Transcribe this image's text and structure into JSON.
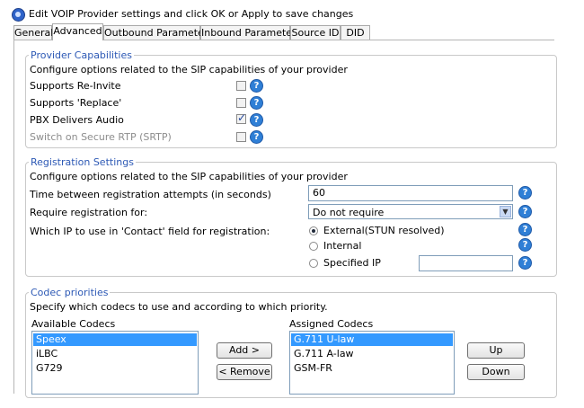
{
  "header": {
    "title": "Edit VOIP Provider settings and click OK or Apply to save changes",
    "icon": "voip-provider-icon"
  },
  "tabs": [
    {
      "label": "General",
      "active": false
    },
    {
      "label": "Advanced",
      "active": true
    },
    {
      "label": "Outbound Parameters",
      "active": false
    },
    {
      "label": "Inbound Parameters",
      "active": false
    },
    {
      "label": "Source ID",
      "active": false
    },
    {
      "label": "DID",
      "active": false
    }
  ],
  "provider_capabilities": {
    "legend": "Provider Capabilities",
    "description": "Configure options related to the SIP capabilities of your provider",
    "options": [
      {
        "label": "Supports Re-Invite",
        "checked": false,
        "enabled": true
      },
      {
        "label": "Supports 'Replace'",
        "checked": false,
        "enabled": true
      },
      {
        "label": "PBX Delivers Audio",
        "checked": true,
        "enabled": true
      },
      {
        "label": "Switch on Secure RTP (SRTP)",
        "checked": false,
        "enabled": false
      }
    ]
  },
  "registration_settings": {
    "legend": "Registration Settings",
    "description": "Configure options related to the SIP capabilities of your provider",
    "time_between_label": "Time between registration attempts (in seconds)",
    "time_between_value": "60",
    "require_label": "Require registration for:",
    "require_value": "Do not require",
    "contact_ip_label": "Which IP to use in 'Contact' field for registration:",
    "contact_ip_options": [
      {
        "label": "External(STUN resolved)",
        "selected": true
      },
      {
        "label": "Internal",
        "selected": false
      },
      {
        "label": "Specified IP",
        "selected": false
      }
    ],
    "specified_ip_value": ""
  },
  "codec_priorities": {
    "legend": "Codec priorities",
    "description": "Specify which codecs to use and according to which priority.",
    "available_label": "Available Codecs",
    "available": [
      "Speex",
      "iLBC",
      "G729"
    ],
    "available_selected": 0,
    "assigned_label": "Assigned Codecs",
    "assigned": [
      "G.711 U-law",
      "G.711 A-law",
      "GSM-FR"
    ],
    "assigned_selected": 0,
    "add_label": "Add >",
    "remove_label": "< Remove",
    "up_label": "Up",
    "down_label": "Down"
  },
  "help_glyph": "?",
  "colors": {
    "legend": "#2d59b5",
    "selection": "#3399ff",
    "help": "#2f7fd6"
  }
}
